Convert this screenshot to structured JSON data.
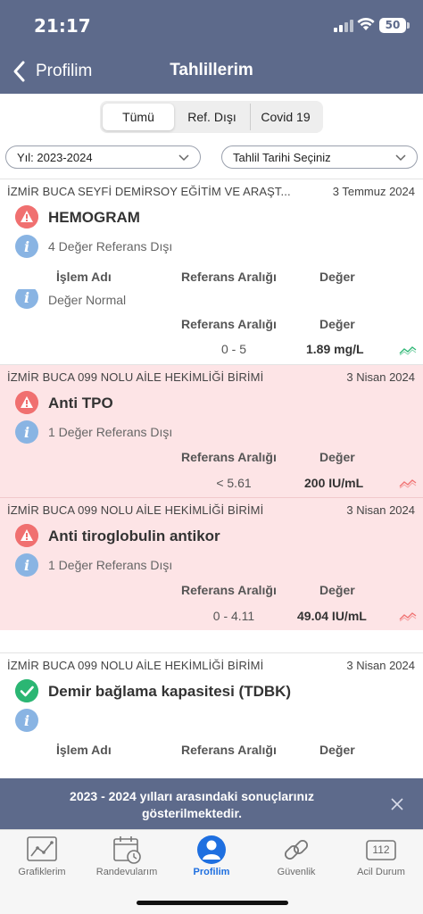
{
  "status_bar": {
    "time": "21:17",
    "battery": "50"
  },
  "nav": {
    "back_label": "Profilim",
    "title": "Tahlillerim"
  },
  "filters": {
    "segments": [
      "Tümü",
      "Ref. Dışı",
      "Covid 19"
    ],
    "active_segment": "Tümü",
    "year_select": "Yıl: 2023-2024",
    "date_select": "Tahlil Tarihi Seçiniz"
  },
  "columns": {
    "islem": "İşlem Adı",
    "referans": "Referans Aralığı",
    "deger": "Değer"
  },
  "results": [
    {
      "institution": "İZMİR BUCA SEYFİ DEMİRSOY EĞİTİM VE ARAŞT...",
      "date": "3 Temmuz 2024",
      "status": "warning",
      "test": "HEMOGRAM",
      "info": "4 Değer Referans Dışı",
      "row_info": "Değer Normal",
      "reference": "0 - 5",
      "value": "1.89 mg/L",
      "trend_color": "#2bb673"
    },
    {
      "institution": "İZMİR BUCA 099 NOLU AİLE HEKİMLİĞİ BİRİMİ",
      "date": "3 Nisan 2024",
      "status": "warning",
      "test": "Anti TPO",
      "info": "1 Değer Referans Dışı",
      "reference": "< 5.61",
      "value": "200  IU/mL",
      "trend_color": "#f07070"
    },
    {
      "institution": "İZMİR BUCA 099 NOLU AİLE HEKİMLİĞİ BİRİMİ",
      "date": "3 Nisan 2024",
      "status": "warning",
      "test": "Anti tiroglobulin antikor",
      "info": "1 Değer Referans Dışı",
      "reference": "0 - 4.11",
      "value": "49.04  IU/mL",
      "trend_color": "#f07070"
    },
    {
      "institution": "İZMİR BUCA 099 NOLU AİLE HEKİMLİĞİ BİRİMİ",
      "date": "3 Nisan 2024",
      "status": "ok",
      "test": "Demir bağlama kapasitesi (TDBK)"
    }
  ],
  "toast": {
    "message": "2023 - 2024 yılları arasındaki sonuçlarınız gösterilmektedir."
  },
  "tabbar": {
    "items": [
      {
        "label": "Grafiklerim",
        "icon": "chart-icon"
      },
      {
        "label": "Randevularım",
        "icon": "calendar-icon"
      },
      {
        "label": "Profilim",
        "icon": "profile-icon",
        "active": true
      },
      {
        "label": "Güvenlik",
        "icon": "link-icon"
      },
      {
        "label": "Acil Durum",
        "icon": "emergency-112-icon",
        "badge": "112"
      }
    ]
  },
  "colors": {
    "header": "#5d6a8b",
    "alert_row": "#fde4e6",
    "active_tab": "#1e6fe0",
    "warning": "#f07070",
    "ok": "#2bb673",
    "info": "#89b4e3"
  }
}
